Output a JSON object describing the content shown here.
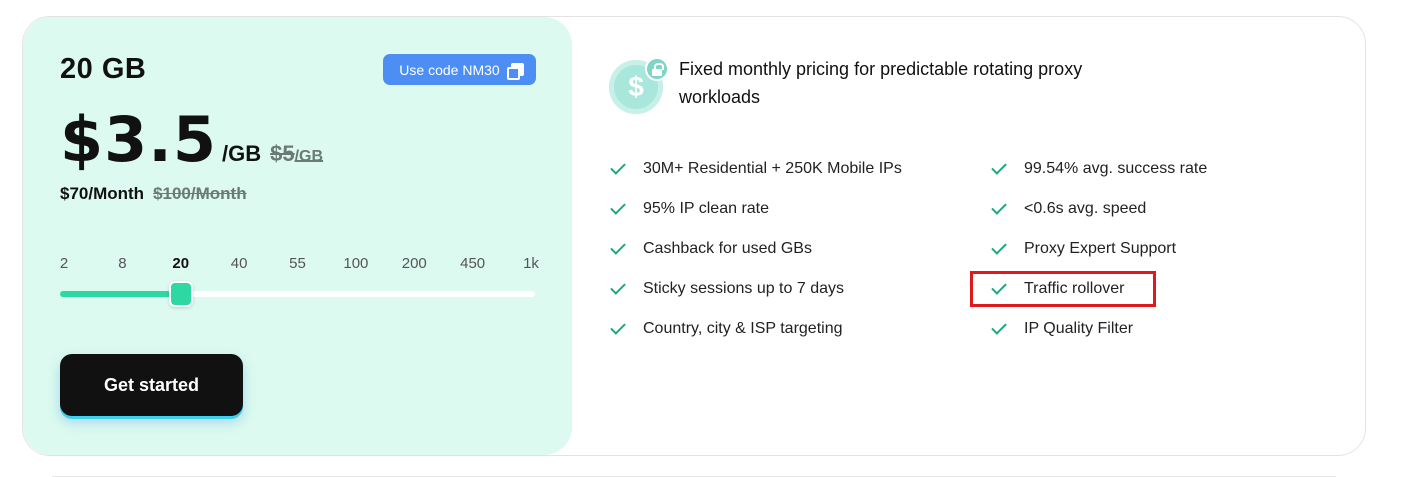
{
  "plan": {
    "size": "20 GB",
    "promo_label": "Use code NM30",
    "price": "$3.5",
    "unit": "/GB",
    "old_price": "$5",
    "old_unit": "/GB",
    "monthly": "$70/Month",
    "monthly_old": "$100/Month",
    "cta_label": "Get started"
  },
  "slider": {
    "ticks": [
      "2",
      "8",
      "20",
      "40",
      "55",
      "100",
      "200",
      "450",
      "1k"
    ],
    "selected_index": 2,
    "fill_fraction": 0.25
  },
  "benefits": {
    "headline": "Fixed monthly pricing for predictable rotating proxy workloads",
    "left": [
      "30M+ Residential + 250K Mobile IPs",
      "95% IP clean rate",
      "Cashback for used GBs",
      "Sticky sessions up to 7 days",
      "Country, city & ISP targeting"
    ],
    "right": [
      "99.54% avg. success rate",
      "<0.6s avg. speed",
      "Proxy Expert Support",
      "Traffic rollover",
      "IP Quality Filter"
    ],
    "highlighted": "Traffic rollover"
  },
  "colors": {
    "panel_bg": "#dcfaef",
    "accent": "#2ed8a2",
    "promo": "#4d8ef4",
    "check": "#1aa97a",
    "highlight": "#e0191d"
  }
}
